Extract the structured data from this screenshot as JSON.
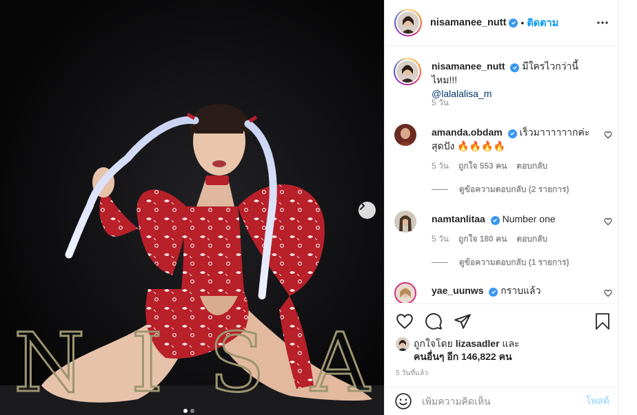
{
  "post": {
    "overlay_letters": [
      "N",
      "I",
      "S",
      "A"
    ],
    "carousel_dots": 2
  },
  "header": {
    "username": "nisamanee_nutt",
    "separator": "•",
    "follow_label": "ติดตาม"
  },
  "caption": {
    "username": "nisamanee_nutt",
    "text": "มีใครไวกว่านี้ไหม!!!",
    "mention": "@lalalalisa_m",
    "time": "5 วัน"
  },
  "comments": [
    {
      "username": "amanda.obdam",
      "text": "เร็วมาาาาาากค่ะ สุดปัง 🔥🔥🔥🔥",
      "time": "5 วัน",
      "likes": "ถูกใจ 553 คน",
      "reply_label": "ตอบกลับ",
      "view_replies": "ดูข้อความตอบกลับ (2 รายการ)"
    },
    {
      "username": "namtanlitaa",
      "text": "Number one",
      "time": "5 วัน",
      "likes": "ถูกใจ 180 คน",
      "reply_label": "ตอบกลับ",
      "view_replies": "ดูข้อความตอบกลับ (1 รายการ)"
    },
    {
      "username": "yae_uunws",
      "text": "กราบแล้ว"
    }
  ],
  "likes": {
    "prefix": "ถูกใจโดย",
    "liker": "lizasadler",
    "conj": "และ",
    "others": "คนอื่นๆ อีก 146,822 คน"
  },
  "timestamp": "5 วันที่แล้ว",
  "add_comment": {
    "placeholder": "เพิ่มความคิดเห็น",
    "post_label": "โพสต์"
  },
  "colors": {
    "link": "#0095f6",
    "verified": "#3897f0",
    "muted": "#8e8e8e",
    "dress": "#b8202a",
    "overlay_text": "#9c9570"
  }
}
